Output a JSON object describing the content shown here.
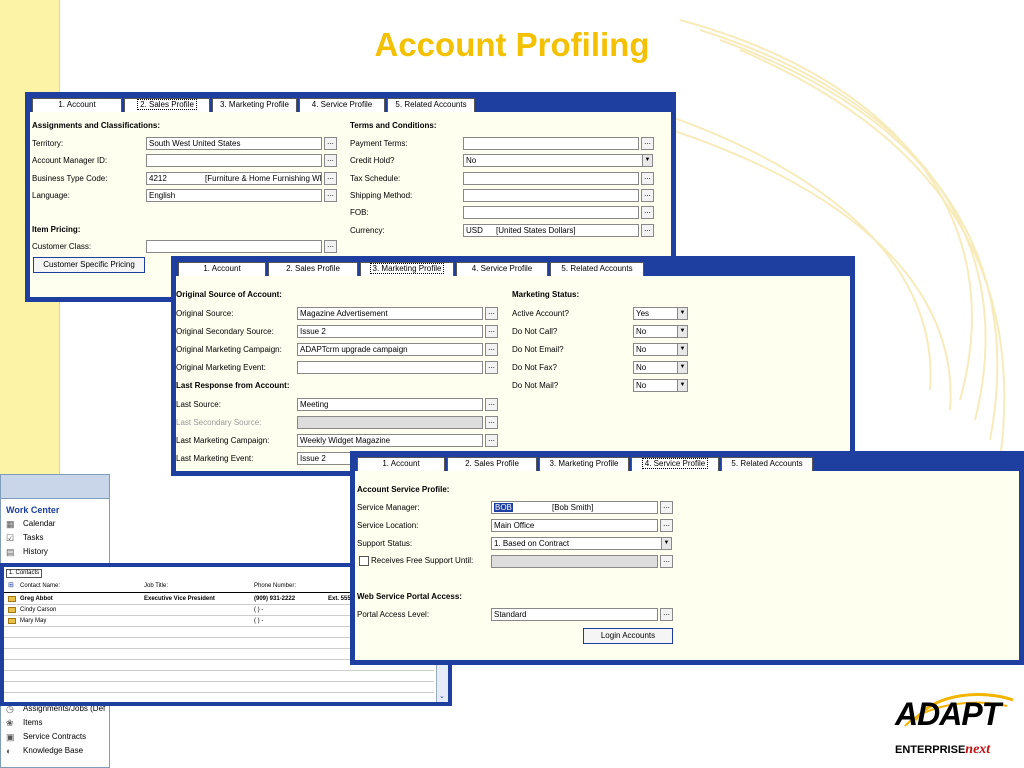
{
  "page_title": "Account Profiling",
  "logo": {
    "name": "ADAPT",
    "sub_left": "ENTERPRISE",
    "sub_right": "next"
  },
  "win1": {
    "tabs": [
      "1. Account",
      "2. Sales Profile",
      "3. Marketing Profile",
      "4. Service Profile",
      "5. Related Accounts"
    ],
    "assign_heading": "Assignments and Classifications:",
    "territory_label": "Territory:",
    "territory_value": "South West United States",
    "manager_label": "Account Manager ID:",
    "manager_value": "",
    "btc_label": "Business Type Code:",
    "btc_value": "4212",
    "btc_desc": "[Furniture & Home Furnishing Wh",
    "language_label": "Language:",
    "language_value": "English",
    "item_heading": "Item Pricing:",
    "customer_class_label": "Customer Class:",
    "customer_class_value": "",
    "csp_button": "Customer Specific Pricing",
    "terms_heading": "Terms and Conditions:",
    "payment_terms_label": "Payment Terms:",
    "payment_terms_value": "",
    "credit_hold_label": "Credit Hold?",
    "credit_hold_value": "No",
    "tax_label": "Tax Schedule:",
    "tax_value": "",
    "shipping_label": "Shipping Method:",
    "shipping_value": "",
    "fob_label": "FOB:",
    "fob_value": "",
    "currency_label": "Currency:",
    "currency_value": "USD",
    "currency_desc": "[United States Dollars]"
  },
  "win2": {
    "tabs": [
      "1. Account",
      "2. Sales Profile",
      "3. Marketing Profile",
      "4. Service Profile",
      "5. Related Accounts"
    ],
    "orig_heading": "Original Source of Account:",
    "orig_source_label": "Original Source:",
    "orig_source_value": "Magazine Advertisement",
    "orig_secondary_label": "Original Secondary Source:",
    "orig_secondary_value": "Issue 2",
    "orig_campaign_label": "Original Marketing Campaign:",
    "orig_campaign_value": "ADAPTcrm upgrade campaign",
    "orig_event_label": "Original Marketing Event:",
    "orig_event_value": "",
    "last_heading": "Last Response from Account:",
    "last_source_label": "Last Source:",
    "last_source_value": "Meeting",
    "last_secondary_label": "Last Secondary Source:",
    "last_secondary_value": "",
    "last_campaign_label": "Last Marketing Campaign:",
    "last_campaign_value": "Weekly Widget Magazine",
    "last_event_label": "Last Marketing Event:",
    "last_event_value": "Issue 2",
    "status_heading": "Marketing Status:",
    "active_label": "Active Account?",
    "active_value": "Yes",
    "dncall_label": "Do Not Call?",
    "dncall_value": "No",
    "dnemail_label": "Do Not Email?",
    "dnemail_value": "No",
    "dnfax_label": "Do Not Fax?",
    "dnfax_value": "No",
    "dnmail_label": "Do Not Mail?",
    "dnmail_value": "No"
  },
  "win3": {
    "tabs": [
      "1. Account",
      "2. Sales Profile",
      "3. Marketing Profile",
      "4. Service Profile",
      "5. Related Accounts"
    ],
    "service_heading": "Account Service Profile:",
    "manager_label": "Service Manager:",
    "manager_value": "BOB",
    "manager_desc": "[Bob Smith]",
    "location_label": "Service Location:",
    "location_value": "Main Office",
    "support_label": "Support Status:",
    "support_value": "1. Based on Contract",
    "free_support_label": "Receives Free Support Until:",
    "free_support_value": "",
    "portal_heading": "Web Service Portal Access:",
    "portal_label": "Portal Access Level:",
    "portal_value": "Standard",
    "login_button": "Login Accounts"
  },
  "work_center": {
    "title": "Work Center",
    "items_top": [
      "Calendar",
      "Tasks",
      "History"
    ],
    "items_bottom": [
      "Assignments/Jobs (Def",
      "Items",
      "Service Contracts",
      "Knowledge Base"
    ]
  },
  "contacts": {
    "tab": "1. Contacts",
    "headers": [
      "Contact Name:",
      "Job Title:",
      "Phone Number:"
    ],
    "rows": [
      {
        "name": "Greg Abbot",
        "title": "Executive Vice President",
        "phone": "(909) 931-2222",
        "ext": "Ext. 555"
      },
      {
        "name": "Cindy Carson",
        "title": "",
        "phone": "(  )   -",
        "ext": ""
      },
      {
        "name": "Mary May",
        "title": "",
        "phone": "(  )   -",
        "ext": ""
      }
    ]
  }
}
